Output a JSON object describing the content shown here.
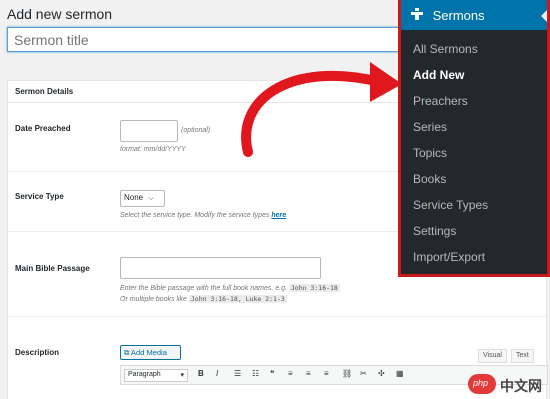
{
  "page": {
    "title": "Add new sermon"
  },
  "title_input": {
    "placeholder": "Sermon title"
  },
  "box": {
    "header": "Sermon Details"
  },
  "date": {
    "label": "Date Preached",
    "optional": "(optional)",
    "format": "format: mm/dd/YYYY"
  },
  "service": {
    "label": "Service Type",
    "selected": "None",
    "hint": "Select the service type. Modify the service types",
    "link": "here",
    "end": "."
  },
  "passage": {
    "label": "Main Bible Passage",
    "hint1": "Enter the Bible passage with the full book names, e.g.",
    "ex1": "John 3:16-18",
    "hint2": "Or multiple books like",
    "ex2": "John 3:16-18, Luke 2:1-3"
  },
  "description": {
    "label": "Description",
    "add_media": "Add Media",
    "tab_visual": "Visual",
    "tab_text": "Text",
    "format": "Paragraph"
  },
  "toolbar": {
    "bold": "B",
    "italic": "I",
    "ul": "☰",
    "ol": "☷",
    "quote": "❝",
    "align_left": "≡",
    "align_center": "≡",
    "align_right": "≡",
    "link": "⛓",
    "unlink": "✂",
    "fullscreen": "✣",
    "kitchen": "▦"
  },
  "sidebar": {
    "title": "Sermons",
    "items": [
      "All Sermons",
      "Add New",
      "Preachers",
      "Series",
      "Topics",
      "Books",
      "Service Types",
      "Settings",
      "Import/Export"
    ]
  },
  "watermark": {
    "badge": "php",
    "text": "中文网"
  },
  "colors": {
    "accent": "#0073aa",
    "highlight": "#cc1818",
    "sidebar_bg": "#23282d"
  }
}
